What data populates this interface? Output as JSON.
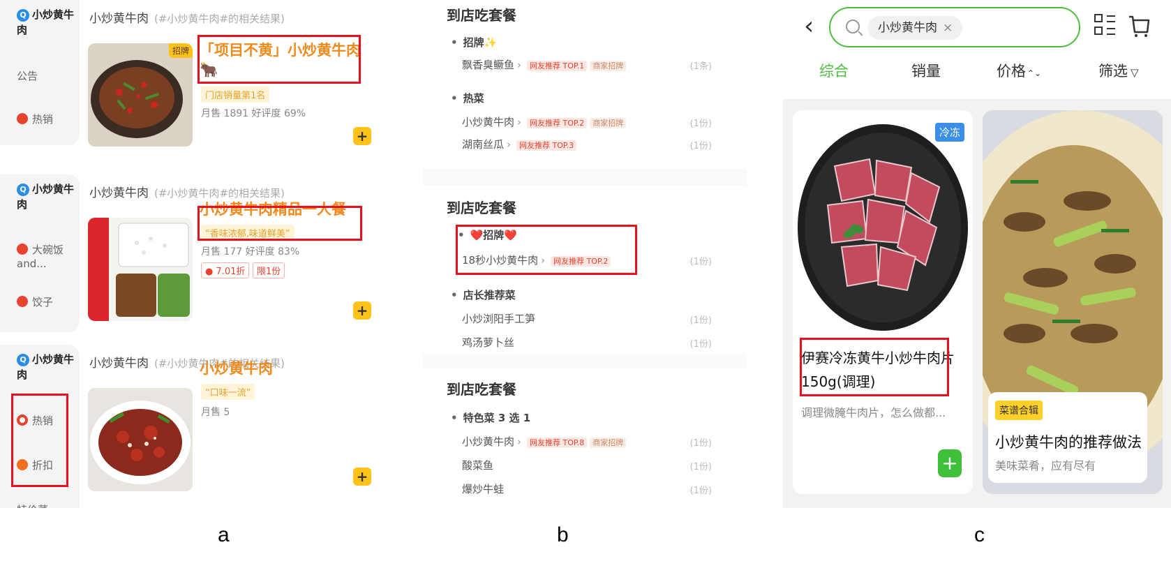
{
  "panel_a": {
    "sections": [
      {
        "shop": "小炒黄牛肉",
        "heading": "小炒黄牛肉",
        "heading_tag": "(#小炒黄牛肉#的相关结果)",
        "side_items": [
          "公告",
          "热销"
        ],
        "badge": "招牌",
        "title": "「项目不黄」小炒黄牛肉🐂",
        "pill": "门店销量第1名",
        "meta": "月售 1891  好评度 69%"
      },
      {
        "shop": "小炒黄牛肉",
        "heading": "小炒黄牛肉",
        "heading_tag": "(#小炒黄牛肉#的相关结果)",
        "side_items": [
          "大碗饭and...",
          "饺子"
        ],
        "title": "小炒黄牛肉精品一人餐",
        "pill": "“香味浓郁,味道鲜美”",
        "meta": "月售 177  好评度 83%",
        "discount": "7.01折",
        "limit": "限1份"
      },
      {
        "shop": "小炒黄牛肉",
        "heading": "小炒黄牛肉",
        "heading_tag": "(#小炒黄牛肉#的相关结果)",
        "side_items": [
          "热销",
          "折扣",
          "特价菜"
        ],
        "title": "小炒黄牛肉",
        "pill": "“口味一流”",
        "meta": "月售 5"
      }
    ],
    "plus_label": "+",
    "caption": "a"
  },
  "panel_b": {
    "cards": [
      {
        "title": "到店吃套餐",
        "groups": [
          {
            "name": "招牌✨",
            "dishes": [
              {
                "name": "飘香臭鳜鱼",
                "tags": [
                  "网友推荐 TOP.1",
                  "商家招牌"
                ],
                "qty": "(1条)"
              }
            ]
          },
          {
            "name": "热菜",
            "dishes": [
              {
                "name": "小炒黄牛肉",
                "tags": [
                  "网友推荐 TOP.2",
                  "商家招牌"
                ],
                "qty": "(1份)"
              },
              {
                "name": "湖南丝瓜",
                "tags": [
                  "网友推荐 TOP.3"
                ],
                "qty": "(1份)"
              }
            ]
          }
        ]
      },
      {
        "title": "到店吃套餐",
        "groups": [
          {
            "name": "❤️招牌❤️",
            "dishes": [
              {
                "name": "18秒小炒黄牛肉",
                "tags": [
                  "网友推荐 TOP.2"
                ],
                "qty": "(1份)"
              }
            ]
          },
          {
            "name": "店长推荐菜",
            "dishes": [
              {
                "name": "小炒浏阳手工笋",
                "tags": [],
                "qty": "(1份)"
              },
              {
                "name": "鸡汤萝卜丝",
                "tags": [],
                "qty": "(1份)"
              }
            ]
          }
        ]
      },
      {
        "title": "到店吃套餐",
        "groups": [
          {
            "name": "特色菜 3 选 1",
            "dishes": [
              {
                "name": "小炒黄牛肉",
                "tags": [
                  "网友推荐 TOP.8",
                  "商家招牌"
                ],
                "qty": "(1份)"
              },
              {
                "name": "酸菜鱼",
                "tags": [],
                "qty": "(1份)"
              },
              {
                "name": "爆炒牛蛙",
                "tags": [],
                "qty": "(1份)"
              }
            ]
          }
        ]
      }
    ],
    "caption": "b"
  },
  "panel_c": {
    "back_icon": "chevron-left-icon",
    "search_chip": "小炒黄牛肉",
    "search_clear": "×",
    "tabs": [
      "综合",
      "销量",
      "价格",
      "筛选"
    ],
    "tab_sort_glyph": "⌃⌄",
    "tab_filter_glyph": "▽",
    "accent": "#4cbd3c",
    "product": {
      "badge": "冷冻",
      "name": "伊赛冷冻黄牛小炒牛肉片150g(调理)",
      "desc": "调理微腌牛肉片，怎么做都...",
      "plus": "+"
    },
    "recipe": {
      "badge": "菜谱合辑",
      "title": "小炒黄牛肉的推荐做法",
      "sub": "美味菜肴，应有尽有"
    },
    "caption": "c"
  }
}
